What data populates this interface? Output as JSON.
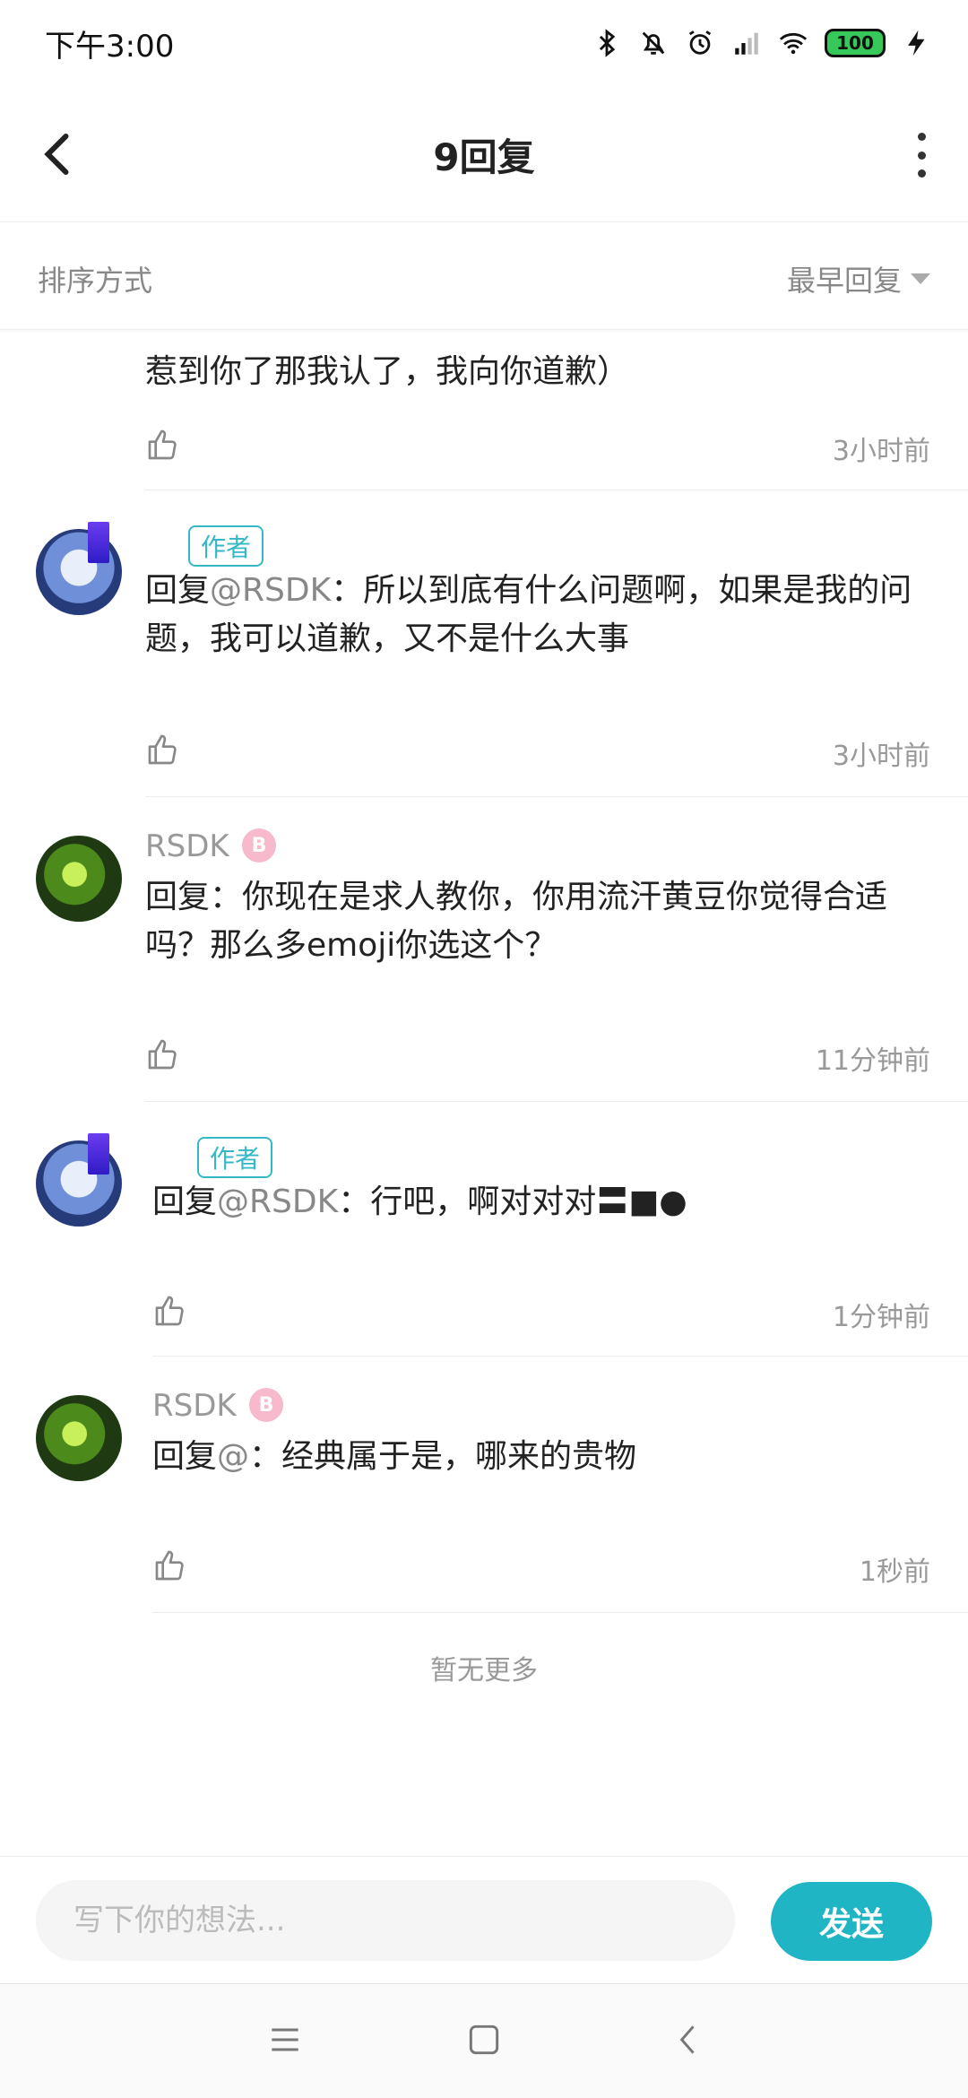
{
  "status_bar": {
    "time": "下午3:00",
    "battery": "100",
    "icons": [
      "bluetooth-icon",
      "mute-bell-icon",
      "alarm-icon",
      "hd-signal-icon",
      "wifi-icon",
      "battery-icon",
      "charging-icon"
    ]
  },
  "header": {
    "title": "9回复",
    "back_icon": "chevron-left-icon",
    "more_icon": "more-vertical-icon"
  },
  "sort": {
    "label": "排序方式",
    "selected": "最早回复"
  },
  "clipped_comment": {
    "text": "惹到你了那我认了，我向你道歉）",
    "time": "3小时前"
  },
  "comments": [
    {
      "author": "",
      "tag": "作者",
      "prefix": "回复",
      "mention": "@RSDK",
      "text": "：所以到底有什么问题啊，如果是我的问题，我可以道歉，又不是什么大事",
      "time": "3小时前"
    },
    {
      "author": "RSDK",
      "badge": "B",
      "prefix": "回复",
      "mention": "",
      "text": "：你现在是求人教你，你用流汗黄豆你觉得合适吗？那么多emoji你选这个？",
      "time": "11分钟前"
    },
    {
      "author": "",
      "tag": "作者",
      "prefix": "回复",
      "mention": "@RSDK",
      "text": "：行吧，啊对对对〓■●",
      "time": "1分钟前"
    },
    {
      "author": "RSDK",
      "badge": "B",
      "prefix": "回复",
      "mention": "@",
      "text": "：经典属于是，哪来的贵物",
      "time": "1秒前"
    }
  ],
  "end_note": "暂无更多",
  "input": {
    "placeholder": "写下你的想法...",
    "send_label": "发送"
  },
  "colors": {
    "accent": "#1fb5c4",
    "tag": "#35b8c6",
    "muted": "#999999"
  }
}
